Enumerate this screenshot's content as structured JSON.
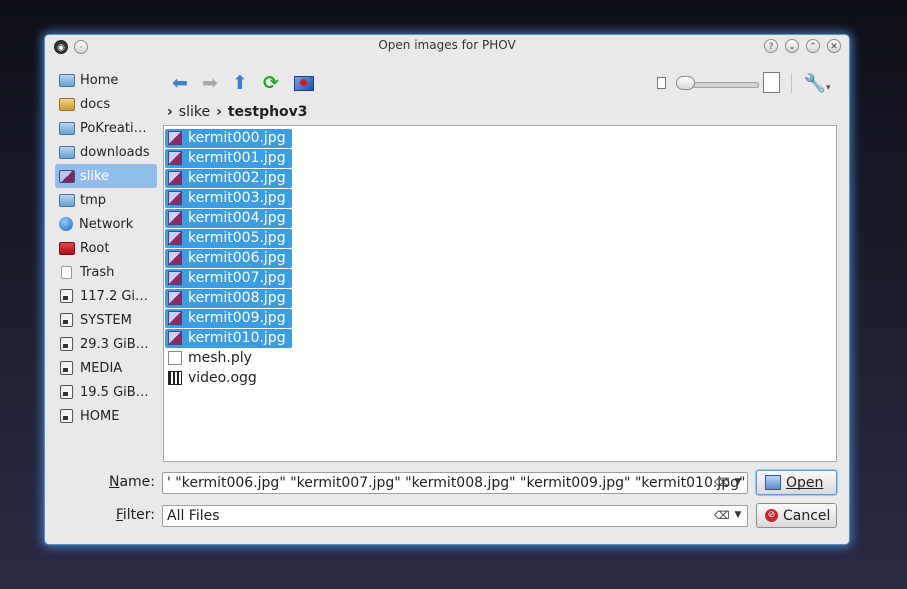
{
  "window": {
    "title": "Open images for PHOV"
  },
  "sidebar": {
    "items": [
      {
        "label": "Home",
        "icon": "folder-home-icon"
      },
      {
        "label": "docs",
        "icon": "folder-docs-icon"
      },
      {
        "label": "PoKreati…",
        "icon": "folder-icon"
      },
      {
        "label": "downloads",
        "icon": "folder-downloads-icon"
      },
      {
        "label": "slike",
        "icon": "folder-pictures-icon",
        "selected": true
      },
      {
        "label": "tmp",
        "icon": "folder-icon"
      },
      {
        "label": "Network",
        "icon": "network-icon"
      },
      {
        "label": "Root",
        "icon": "folder-root-icon"
      },
      {
        "label": "Trash",
        "icon": "trash-icon"
      },
      {
        "label": "117.2 Gi…",
        "icon": "drive-icon"
      },
      {
        "label": "SYSTEM",
        "icon": "drive-icon"
      },
      {
        "label": "29.3 GiB…",
        "icon": "drive-icon"
      },
      {
        "label": "MEDIA",
        "icon": "drive-icon"
      },
      {
        "label": "19.5 GiB…",
        "icon": "drive-icon"
      },
      {
        "label": "HOME",
        "icon": "drive-icon"
      }
    ]
  },
  "breadcrumb": {
    "parent": "slike",
    "current": "testphov3"
  },
  "files": [
    {
      "name": "kermit000.jpg",
      "type": "image",
      "selected": true
    },
    {
      "name": "kermit001.jpg",
      "type": "image",
      "selected": true
    },
    {
      "name": "kermit002.jpg",
      "type": "image",
      "selected": true
    },
    {
      "name": "kermit003.jpg",
      "type": "image",
      "selected": true
    },
    {
      "name": "kermit004.jpg",
      "type": "image",
      "selected": true
    },
    {
      "name": "kermit005.jpg",
      "type": "image",
      "selected": true
    },
    {
      "name": "kermit006.jpg",
      "type": "image",
      "selected": true
    },
    {
      "name": "kermit007.jpg",
      "type": "image",
      "selected": true
    },
    {
      "name": "kermit008.jpg",
      "type": "image",
      "selected": true
    },
    {
      "name": "kermit009.jpg",
      "type": "image",
      "selected": true
    },
    {
      "name": "kermit010.jpg",
      "type": "image",
      "selected": true
    },
    {
      "name": "mesh.ply",
      "type": "document",
      "selected": false
    },
    {
      "name": "video.ogg",
      "type": "video",
      "selected": false
    }
  ],
  "name_row": {
    "label": "Name:",
    "value": "' \"kermit006.jpg\" \"kermit007.jpg\" \"kermit008.jpg\" \"kermit009.jpg\" \"kermit010.jpg\""
  },
  "filter_row": {
    "label": "Filter:",
    "value": "All Files"
  },
  "buttons": {
    "open": "Open",
    "cancel": "Cancel"
  },
  "colors": {
    "selection": "#3b9de2",
    "window_glow": "#5096e6"
  }
}
